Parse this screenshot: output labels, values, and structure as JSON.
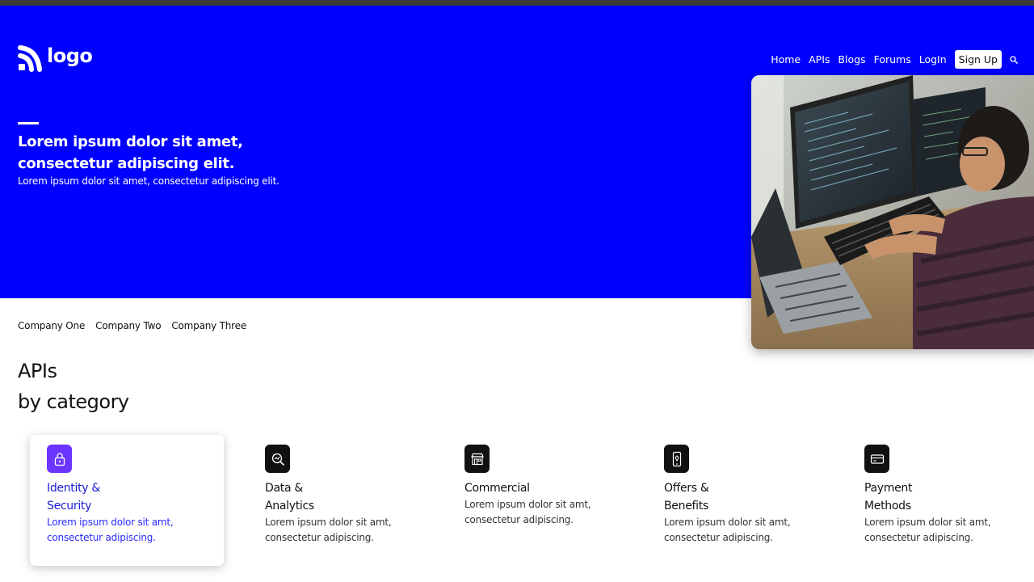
{
  "brand": {
    "name": "logo"
  },
  "nav": {
    "links": [
      "Home",
      "APIs",
      "Blogs",
      "Forums",
      "LogIn"
    ],
    "signup_label": "Sign Up"
  },
  "hero": {
    "title_line1": "Lorem ipsum dolor sit amet,",
    "title_line2": "consectetur adipiscing elit.",
    "subtitle": "Lorem ipsum dolor sit amet, consectetur adipiscing elit."
  },
  "companies": [
    "Company One",
    "Company Two",
    "Company Three"
  ],
  "apis": {
    "title_line1": "APIs",
    "title_line2": "by category"
  },
  "categories": [
    {
      "title_line1": "Identity &",
      "title_line2": "Security",
      "desc_line1": "Lorem ipsum dolor sit amt,",
      "desc_line2": "consectetur adipiscing.",
      "icon": "lock-icon",
      "active": true
    },
    {
      "title_line1": "Data &",
      "title_line2": "Analytics",
      "desc_line1": "Lorem ipsum dolor sit amt,",
      "desc_line2": "consectetur adipiscing.",
      "icon": "magnifier-chart-icon",
      "active": false
    },
    {
      "title_line1": "Commercial",
      "title_line2": "",
      "desc_line1": "Lorem ipsum dolor sit amt,",
      "desc_line2": "consectetur adipiscing.",
      "icon": "storefront-icon",
      "active": false
    },
    {
      "title_line1": "Offers &",
      "title_line2": "Benefits",
      "desc_line1": "Lorem ipsum dolor sit amt,",
      "desc_line2": "consectetur adipiscing.",
      "icon": "mobile-offer-icon",
      "active": false
    },
    {
      "title_line1": "Payment",
      "title_line2": "Methods",
      "desc_line1": "Lorem ipsum dolor sit amt,",
      "desc_line2": "consectetur adipiscing.",
      "icon": "credit-card-icon",
      "active": false
    }
  ],
  "colors": {
    "hero_bg": "#0000ff",
    "active_icon_bg": "#6b35ff",
    "active_text": "#1a1ad8"
  }
}
